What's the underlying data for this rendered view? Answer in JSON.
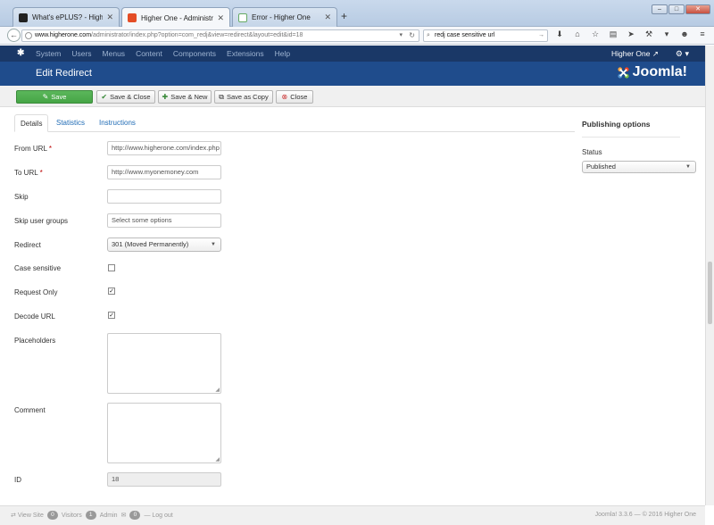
{
  "browser": {
    "tabs": [
      {
        "title": "What's ePLUS? - Higher One",
        "favicon_color": "#222222",
        "active": false
      },
      {
        "title": "Higher One - Administrati...",
        "favicon_color": "#e44d26",
        "active": true
      },
      {
        "title": "Error - Higher One",
        "favicon_color": "#f0f0f0",
        "active": false
      }
    ],
    "new_tab": "+",
    "url_host": "www.higherone.com",
    "url_path": "/administrator/index.php?option=com_redj&view=redirect&layout=edit&id=18",
    "search_value": "redj case sensitive url"
  },
  "joomla": {
    "topmenu": [
      "System",
      "Users",
      "Menus",
      "Content",
      "Components",
      "Extensions",
      "Help"
    ],
    "user": "Higher One",
    "page_title": "Edit Redirect",
    "brand": "Joomla!"
  },
  "toolbar": {
    "save": "Save",
    "save_close": "Save & Close",
    "save_new": "Save & New",
    "save_copy": "Save as Copy",
    "close": "Close"
  },
  "tabs": {
    "details": "Details",
    "statistics": "Statistics",
    "instructions": "Instructions"
  },
  "form": {
    "from_url_label": "From URL",
    "from_url_value": "http://www.higherone.com/index.php",
    "to_url_label": "To URL",
    "to_url_value": "http://www.myonemoney.com",
    "skip_label": "Skip",
    "skip_value": "",
    "skip_groups_label": "Skip user groups",
    "skip_groups_placeholder": "Select some options",
    "redirect_label": "Redirect",
    "redirect_value": "301 (Moved Permanently)",
    "case_label": "Case sensitive",
    "case_checked": false,
    "request_label": "Request Only",
    "request_checked": true,
    "decode_label": "Decode URL",
    "decode_checked": true,
    "placeholders_label": "Placeholders",
    "comment_label": "Comment",
    "id_label": "ID",
    "id_value": "18",
    "required_mark": "*"
  },
  "publishing": {
    "title": "Publishing options",
    "status_label": "Status",
    "status_value": "Published"
  },
  "footer": {
    "view_site": "View Site",
    "visitors_count": "0",
    "visitors": "Visitors",
    "admin_count": "1",
    "admin": "Admin",
    "messages_count": "0",
    "logout": "Log out",
    "version": "Joomla! 3.3.6 — © 2016 Higher One"
  }
}
